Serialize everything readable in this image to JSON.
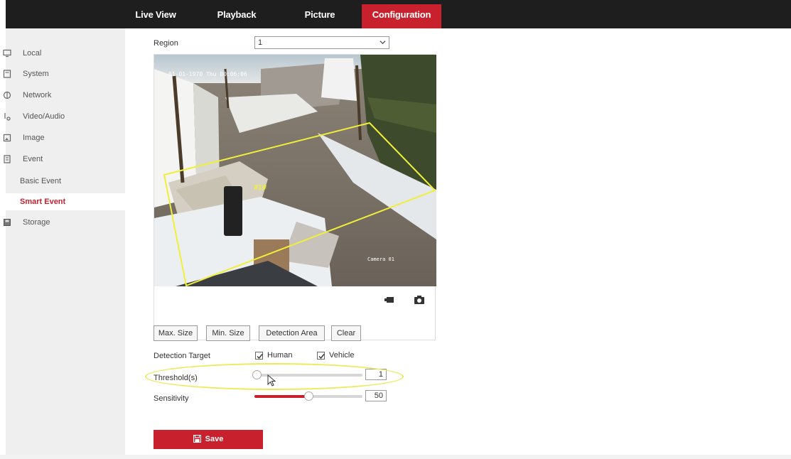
{
  "nav": {
    "tabs": [
      {
        "label": "Live View"
      },
      {
        "label": "Playback"
      },
      {
        "label": "Picture"
      },
      {
        "label": "Configuration",
        "active": true
      }
    ]
  },
  "sidebar": {
    "items": [
      {
        "label": "Local",
        "icon": "monitor-icon"
      },
      {
        "label": "System",
        "icon": "system-icon"
      },
      {
        "label": "Network",
        "icon": "network-icon"
      },
      {
        "label": "Video/Audio",
        "icon": "video-audio-icon"
      },
      {
        "label": "Image",
        "icon": "image-icon"
      },
      {
        "label": "Event",
        "icon": "event-icon"
      },
      {
        "label": "Basic Event",
        "sub": true
      },
      {
        "label": "Smart Event",
        "sub": true,
        "selected": true
      },
      {
        "label": "Storage",
        "icon": "storage-icon"
      }
    ]
  },
  "region": {
    "label": "Region",
    "value": "1"
  },
  "video": {
    "osd_timestamp": "01-01-1970 Thu 00:06:06",
    "zone_label": "#1#",
    "camera_name": "Camera 01"
  },
  "buttons": {
    "max_size": "Max. Size",
    "min_size": "Min. Size",
    "detection_area": "Detection Area",
    "clear": "Clear"
  },
  "detection_target": {
    "label": "Detection Target",
    "human": {
      "label": "Human",
      "checked": true
    },
    "vehicle": {
      "label": "Vehicle",
      "checked": true
    }
  },
  "threshold": {
    "label": "Threshold(s)",
    "value": "1",
    "fraction": 0.02
  },
  "sensitivity": {
    "label": "Sensitivity",
    "value": "50",
    "fraction": 0.5
  },
  "save": {
    "label": "Save"
  },
  "colors": {
    "accent": "#c8202d",
    "topbar": "#1e1e1e",
    "sidebar": "#efefef",
    "highlight": "#ecea5a",
    "detection_zone": "#f0ef3a"
  }
}
